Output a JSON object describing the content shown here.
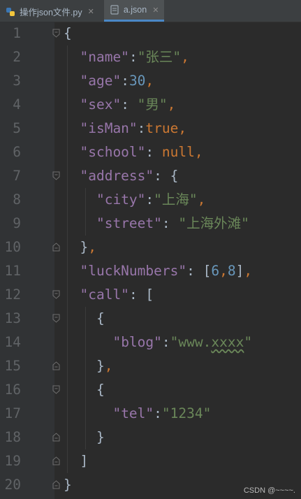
{
  "tabs": [
    {
      "label": "操作json文件.py",
      "icon": "python-file-icon"
    },
    {
      "label": "a.json",
      "icon": "json-file-icon"
    }
  ],
  "editor": {
    "line_numbers": [
      "1",
      "2",
      "3",
      "4",
      "5",
      "6",
      "7",
      "8",
      "9",
      "10",
      "11",
      "12",
      "13",
      "14",
      "15",
      "16",
      "17",
      "18",
      "19",
      "20"
    ],
    "lines": [
      [
        {
          "t": "{",
          "c": "plain"
        }
      ],
      [
        {
          "t": "  ",
          "c": "plain"
        },
        {
          "t": "\"name\"",
          "c": "key"
        },
        {
          "t": ":",
          "c": "plain"
        },
        {
          "t": "\"张三\"",
          "c": "str"
        },
        {
          "t": ",",
          "c": "pun"
        }
      ],
      [
        {
          "t": "  ",
          "c": "plain"
        },
        {
          "t": "\"age\"",
          "c": "key"
        },
        {
          "t": ":",
          "c": "plain"
        },
        {
          "t": "30",
          "c": "num"
        },
        {
          "t": ",",
          "c": "pun"
        }
      ],
      [
        {
          "t": "  ",
          "c": "plain"
        },
        {
          "t": "\"sex\"",
          "c": "key"
        },
        {
          "t": ": ",
          "c": "plain"
        },
        {
          "t": "\"男\"",
          "c": "str"
        },
        {
          "t": ",",
          "c": "pun"
        }
      ],
      [
        {
          "t": "  ",
          "c": "plain"
        },
        {
          "t": "\"isMan\"",
          "c": "key"
        },
        {
          "t": ":",
          "c": "plain"
        },
        {
          "t": "true",
          "c": "kw"
        },
        {
          "t": ",",
          "c": "pun"
        }
      ],
      [
        {
          "t": "  ",
          "c": "plain"
        },
        {
          "t": "\"school\"",
          "c": "key"
        },
        {
          "t": ": ",
          "c": "plain"
        },
        {
          "t": "null",
          "c": "kw"
        },
        {
          "t": ",",
          "c": "pun"
        }
      ],
      [
        {
          "t": "  ",
          "c": "plain"
        },
        {
          "t": "\"address\"",
          "c": "key"
        },
        {
          "t": ": ",
          "c": "plain"
        },
        {
          "t": "{",
          "c": "plain"
        }
      ],
      [
        {
          "t": "    ",
          "c": "plain"
        },
        {
          "t": "\"city\"",
          "c": "key"
        },
        {
          "t": ":",
          "c": "plain"
        },
        {
          "t": "\"上海\"",
          "c": "str"
        },
        {
          "t": ",",
          "c": "pun"
        }
      ],
      [
        {
          "t": "    ",
          "c": "plain"
        },
        {
          "t": "\"street\"",
          "c": "key"
        },
        {
          "t": ": ",
          "c": "plain"
        },
        {
          "t": "\"上海外滩\"",
          "c": "str"
        }
      ],
      [
        {
          "t": "  ",
          "c": "plain"
        },
        {
          "t": "}",
          "c": "plain"
        },
        {
          "t": ",",
          "c": "pun"
        }
      ],
      [
        {
          "t": "  ",
          "c": "plain"
        },
        {
          "t": "\"luckNumbers\"",
          "c": "key"
        },
        {
          "t": ": ",
          "c": "plain"
        },
        {
          "t": "[",
          "c": "plain"
        },
        {
          "t": "6",
          "c": "num"
        },
        {
          "t": ",",
          "c": "pun"
        },
        {
          "t": "8",
          "c": "num"
        },
        {
          "t": "]",
          "c": "plain"
        },
        {
          "t": ",",
          "c": "pun"
        }
      ],
      [
        {
          "t": "  ",
          "c": "plain"
        },
        {
          "t": "\"call\"",
          "c": "key"
        },
        {
          "t": ": ",
          "c": "plain"
        },
        {
          "t": "[",
          "c": "plain"
        }
      ],
      [
        {
          "t": "    ",
          "c": "plain"
        },
        {
          "t": "{",
          "c": "plain"
        }
      ],
      [
        {
          "t": "      ",
          "c": "plain"
        },
        {
          "t": "\"blog\"",
          "c": "key"
        },
        {
          "t": ":",
          "c": "plain"
        },
        {
          "t": "\"www.",
          "c": "str"
        },
        {
          "t": "xxxx",
          "c": "str squig"
        },
        {
          "t": "\"",
          "c": "str"
        }
      ],
      [
        {
          "t": "    ",
          "c": "plain"
        },
        {
          "t": "}",
          "c": "plain"
        },
        {
          "t": ",",
          "c": "pun"
        }
      ],
      [
        {
          "t": "    ",
          "c": "plain"
        },
        {
          "t": "{",
          "c": "plain"
        }
      ],
      [
        {
          "t": "      ",
          "c": "plain"
        },
        {
          "t": "\"tel\"",
          "c": "key"
        },
        {
          "t": ":",
          "c": "plain"
        },
        {
          "t": "\"1234\"",
          "c": "str"
        }
      ],
      [
        {
          "t": "    ",
          "c": "plain"
        },
        {
          "t": "}",
          "c": "plain"
        }
      ],
      [
        {
          "t": "  ",
          "c": "plain"
        },
        {
          "t": "]",
          "c": "plain"
        }
      ],
      [
        {
          "t": "}",
          "c": "plain"
        }
      ]
    ],
    "fold_open_lines": [
      1,
      7,
      12,
      13,
      16
    ],
    "fold_close_lines": [
      10,
      15,
      18,
      19,
      20
    ]
  },
  "watermark": "CSDN @~~~~."
}
